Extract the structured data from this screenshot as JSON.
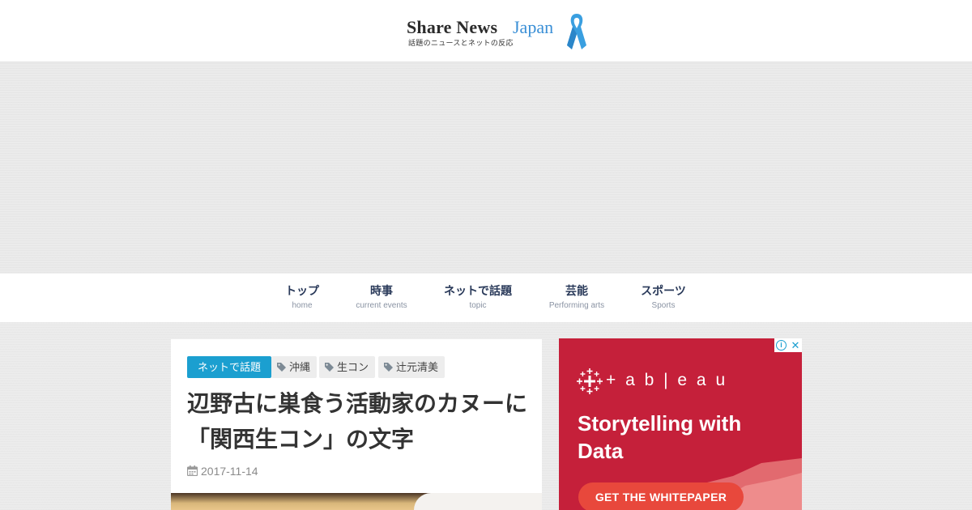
{
  "header": {
    "logo_share": "Share News",
    "logo_japan": "Japan",
    "logo_subtitle": "話題のニュースとネットの反応",
    "brand_blue": "#3a8fd6"
  },
  "nav": {
    "items": [
      {
        "label": "トップ",
        "sub": "home"
      },
      {
        "label": "時事",
        "sub": "current events"
      },
      {
        "label": "ネットで話題",
        "sub": "topic"
      },
      {
        "label": "芸能",
        "sub": "Performing arts"
      },
      {
        "label": "スポーツ",
        "sub": "Sports"
      }
    ]
  },
  "article": {
    "category": "ネットで話題",
    "category_color": "#1b9fd0",
    "tags": [
      "沖縄",
      "生コン",
      "辻元清美"
    ],
    "title": "辺野古に巣食う活動家のカヌーに「関西生コン」の文字",
    "date": "2017-11-14"
  },
  "ad": {
    "brand": "+ a b | e a u",
    "headline": "Storytelling with Data",
    "cta": "GET THE WHITEPAPER",
    "background_color": "#c5203a",
    "cta_color": "#e8483c",
    "info_icon": "i",
    "close_icon": "✕"
  }
}
